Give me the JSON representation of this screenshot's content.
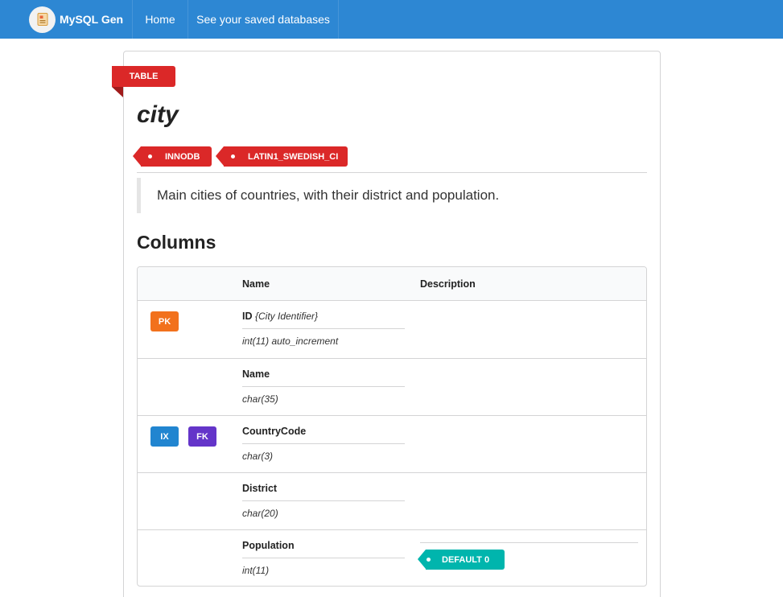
{
  "nav": {
    "brand": "MySQL Gen",
    "items": [
      "Home",
      "See your saved databases"
    ]
  },
  "colors": {
    "topbar": "#2d87d3",
    "red": "#db2828",
    "orange": "#f2711c",
    "blue": "#2185d0",
    "violet": "#6435c9",
    "teal": "#00b5ad"
  },
  "table": {
    "ribbon": "TABLE",
    "name": "city",
    "engine": "INNODB",
    "collation": "LATIN1_SWEDISH_CI",
    "description": "Main cities of countries, with their district and population."
  },
  "columns_section": {
    "title": "Columns",
    "headers": [
      "",
      "Name",
      "Description"
    ],
    "rows": [
      {
        "badges": [
          "PK"
        ],
        "name": "ID",
        "comment": "{City Identifier}",
        "type": "int(11) auto_increment",
        "default": ""
      },
      {
        "badges": [],
        "name": "Name",
        "comment": "",
        "type": "char(35)",
        "default": ""
      },
      {
        "badges": [
          "IX",
          "FK"
        ],
        "name": "CountryCode",
        "comment": "",
        "type": "char(3)",
        "default": ""
      },
      {
        "badges": [],
        "name": "District",
        "comment": "",
        "type": "char(20)",
        "default": ""
      },
      {
        "badges": [],
        "name": "Population",
        "comment": "",
        "type": "int(11)",
        "default": "DEFAULT 0"
      }
    ]
  }
}
